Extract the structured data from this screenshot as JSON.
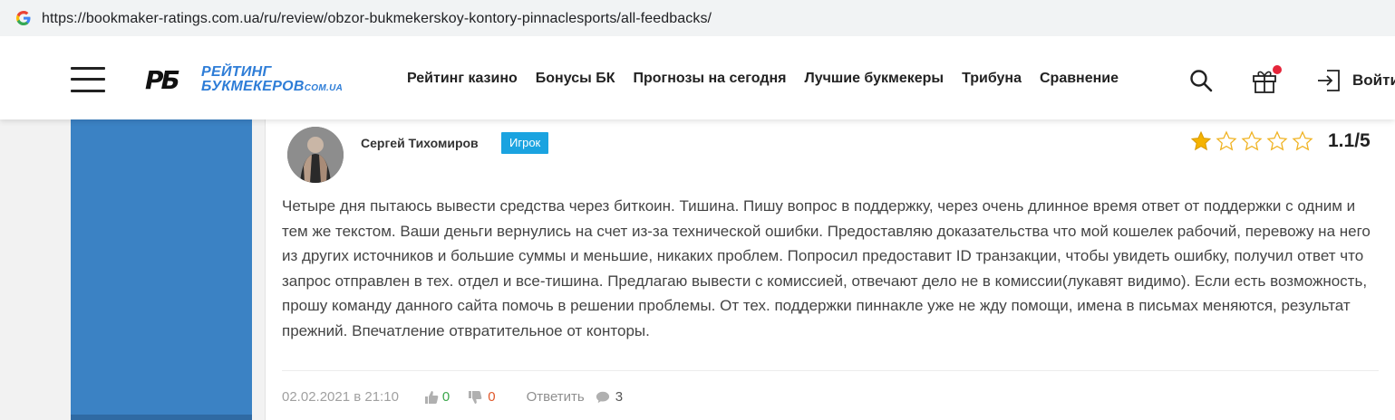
{
  "browser": {
    "url": "https://bookmaker-ratings.com.ua/ru/review/obzor-bukmekerskoy-kontory-pinnaclesports/all-feedbacks/"
  },
  "site": {
    "logo_mark": "РБ",
    "logo_line1": "РЕЙТИНГ",
    "logo_line2": "БУКМЕКЕРОВ",
    "logo_domain": "COM.UA",
    "nav": [
      {
        "label": "Рейтинг казино"
      },
      {
        "label": "Бонусы БК"
      },
      {
        "label": "Прогнозы на сегодня"
      },
      {
        "label": "Лучшие букмекеры"
      },
      {
        "label": "Трибуна"
      },
      {
        "label": "Сравнение"
      }
    ],
    "login_label": "Войти",
    "gift_notification_color": "#e5253a",
    "accent_color": "#2e7dd7"
  },
  "review": {
    "author": "Сергей Тихомиров",
    "role_badge": "Игрок",
    "rating_filled_stars": 1,
    "rating_total_stars": 5,
    "rating_value": "1.1/5",
    "text": "Четыре дня пытаюсь вывести средства через биткоин. Тишина. Пишу вопрос в поддержку, через очень длинное время ответ от поддержки с одним и тем же текстом. Ваши деньги вернулись на счет из-за технической ошибки. Предоставляю доказательства что мой кошелек рабочий, перевожу на него из других источников и большие суммы и меньшие, никаких проблем. Попросил предоставит ID транзакции, чтобы увидеть ошибку, получил ответ что запрос отправлен в тех. отдел и все-тишина. Предлагаю вывести с комиссией, отвечают дело не в комиссии(лукавят видимо). Если есть возможность, прошу команду данного сайта помочь в решении проблемы. От тех. поддержки пиннакле уже не жду помощи, имена в письмах меняются, результат прежний. Впечатление отвратительное от конторы.",
    "date": "02.02.2021 в 21:10",
    "likes": "0",
    "dislikes": "0",
    "reply_label": "Ответить",
    "comments": "3",
    "badge_color": "#1aa3e0",
    "star_color": "#f5b301"
  }
}
